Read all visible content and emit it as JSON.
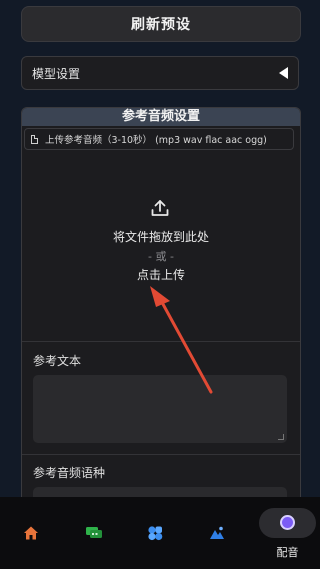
{
  "header": {
    "refresh_label": "刷新预设"
  },
  "model_settings": {
    "label": "模型设置"
  },
  "ref_audio": {
    "title": "参考音频设置",
    "file_label": "上传参考音频（3-10秒） (mp3 wav flac aac ogg)",
    "drop_text": "将文件拖放到此处",
    "or_text": "- 或 -",
    "click_text": "点击上传",
    "ref_text_label": "参考文本",
    "ref_lang_label": "参考音频语种"
  },
  "bottom_nav": {
    "items": [
      {
        "icon": "home-icon",
        "color": "#e8743b"
      },
      {
        "icon": "chat-icon",
        "color": "#2fb34a"
      },
      {
        "icon": "apps-icon",
        "color": "#3d8ff0"
      },
      {
        "icon": "image-icon",
        "color": "#2f7fe6"
      }
    ],
    "active": {
      "icon": "voice-icon",
      "label": "配音",
      "color": "#7b5cf5"
    }
  },
  "annotation_color": "#e24a34"
}
